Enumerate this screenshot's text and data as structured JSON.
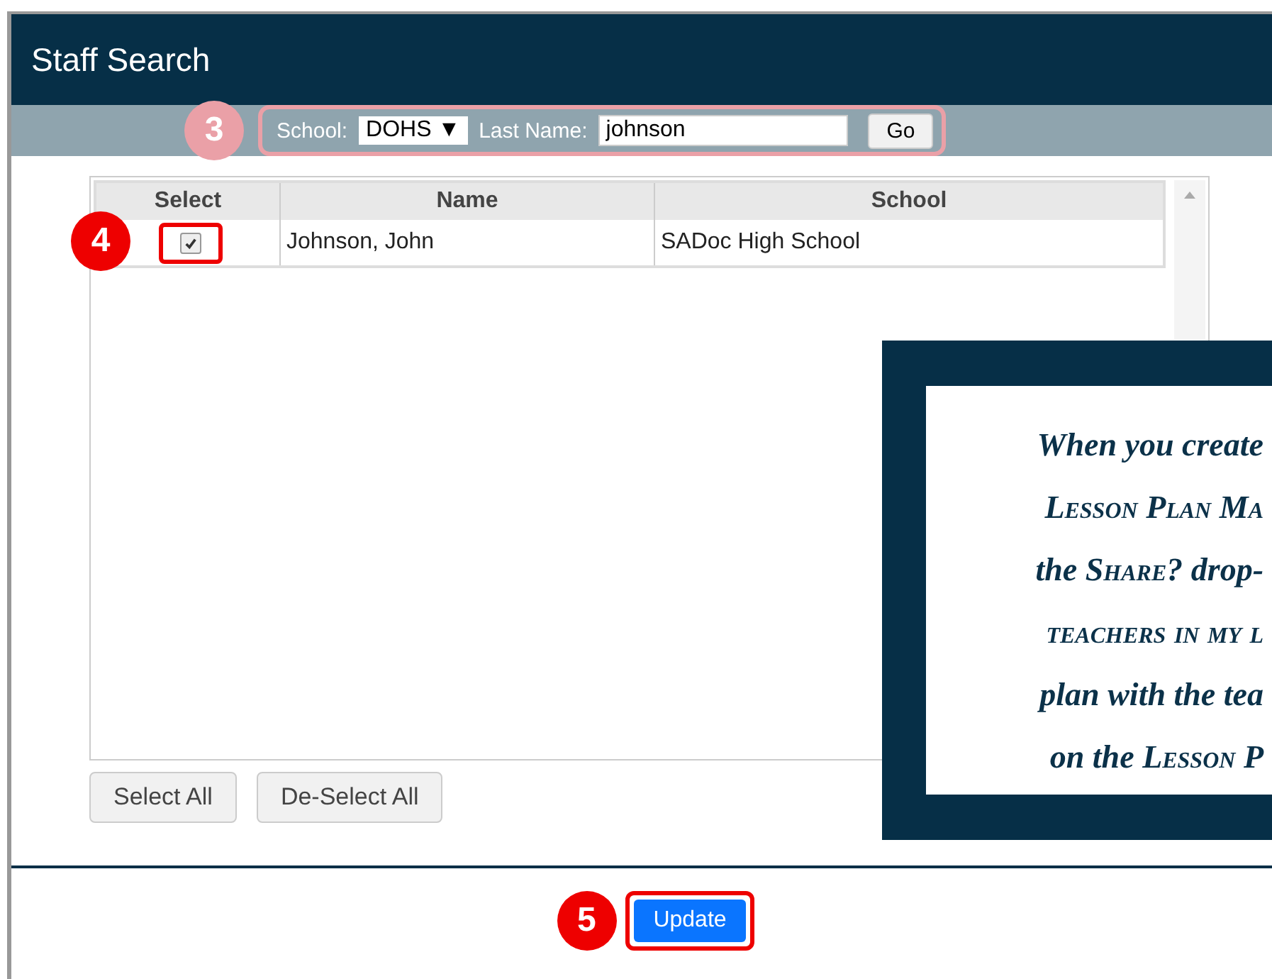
{
  "window": {
    "title": "Staff Search"
  },
  "search": {
    "step": "3",
    "school_label": "School:",
    "school_value": "DOHS",
    "dropdown_glyph": "▼",
    "last_name_label": "Last Name:",
    "last_name_value": "johnson",
    "go_button": "Go"
  },
  "table": {
    "step": "4",
    "columns": [
      "Select",
      "Name",
      "School"
    ],
    "rows": [
      {
        "checked": true,
        "name": "Johnson, John",
        "school": "SADoc High School"
      }
    ]
  },
  "list_buttons": [
    "Select All",
    "De-Select All"
  ],
  "update": {
    "step": "5",
    "label": "Update"
  },
  "callout": {
    "lines": [
      [
        {
          "text": "When you create",
          "smallcaps": false
        }
      ],
      [
        {
          "text": "Lesson Plan Ma",
          "smallcaps": true
        }
      ],
      [
        {
          "text": "the ",
          "smallcaps": false
        },
        {
          "text": "Share?",
          "smallcaps": true
        },
        {
          "text": " drop-",
          "smallcaps": false
        }
      ],
      [
        {
          "text": "teachers in my l",
          "smallcaps": true
        }
      ],
      [
        {
          "text": "plan with the tea",
          "smallcaps": false
        }
      ],
      [
        {
          "text": "on the ",
          "smallcaps": false
        },
        {
          "text": "Lesson P",
          "smallcaps": true
        }
      ]
    ]
  }
}
